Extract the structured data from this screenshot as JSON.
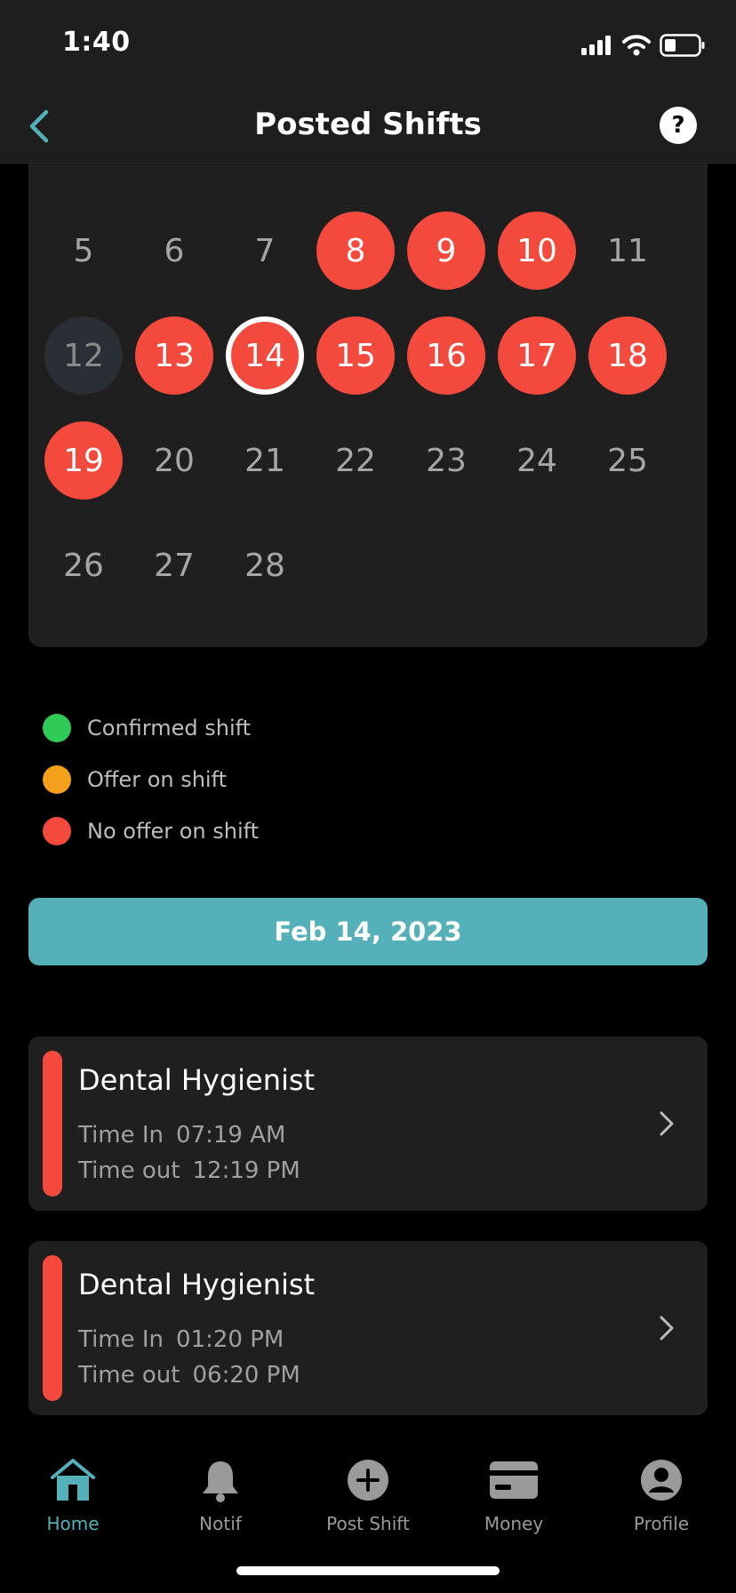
{
  "status_bar": {
    "time": "1:40"
  },
  "header": {
    "title": "Posted Shifts",
    "help_label": "?"
  },
  "calendar": {
    "days": [
      {
        "label": "5",
        "state": "none"
      },
      {
        "label": "6",
        "state": "none"
      },
      {
        "label": "7",
        "state": "none"
      },
      {
        "label": "8",
        "state": "no-offer"
      },
      {
        "label": "9",
        "state": "no-offer"
      },
      {
        "label": "10",
        "state": "no-offer"
      },
      {
        "label": "11",
        "state": "none"
      },
      {
        "label": "12",
        "state": "today"
      },
      {
        "label": "13",
        "state": "no-offer"
      },
      {
        "label": "14",
        "state": "selected"
      },
      {
        "label": "15",
        "state": "no-offer"
      },
      {
        "label": "16",
        "state": "no-offer"
      },
      {
        "label": "17",
        "state": "no-offer"
      },
      {
        "label": "18",
        "state": "no-offer"
      },
      {
        "label": "19",
        "state": "no-offer"
      },
      {
        "label": "20",
        "state": "none"
      },
      {
        "label": "21",
        "state": "none"
      },
      {
        "label": "22",
        "state": "none"
      },
      {
        "label": "23",
        "state": "none"
      },
      {
        "label": "24",
        "state": "none"
      },
      {
        "label": "25",
        "state": "none"
      },
      {
        "label": "26",
        "state": "none"
      },
      {
        "label": "27",
        "state": "none"
      },
      {
        "label": "28",
        "state": "none"
      }
    ]
  },
  "legend": [
    {
      "label": "Confirmed shift",
      "color": "#2ecc57"
    },
    {
      "label": "Offer on shift",
      "color": "#f5a01a"
    },
    {
      "label": "No offer on shift",
      "color": "#f44a3e"
    }
  ],
  "selected_date": "Feb 14, 2023",
  "shifts": [
    {
      "title": "Dental Hygienist",
      "time_in_label": "Time In",
      "time_in": "07:19 AM",
      "time_out_label": "Time out",
      "time_out": "12:19 PM"
    },
    {
      "title": "Dental Hygienist",
      "time_in_label": "Time In",
      "time_in": "01:20 PM",
      "time_out_label": "Time out",
      "time_out": "06:20 PM"
    }
  ],
  "tabs": [
    {
      "label": "Home",
      "icon": "home-icon",
      "active": true
    },
    {
      "label": "Notif",
      "icon": "bell-icon",
      "active": false
    },
    {
      "label": "Post Shift",
      "icon": "plus-circle-icon",
      "active": false
    },
    {
      "label": "Money",
      "icon": "card-icon",
      "active": false
    },
    {
      "label": "Profile",
      "icon": "profile-icon",
      "active": false
    }
  ],
  "colors": {
    "accent": "#54b1b9",
    "no_offer": "#f44a3e",
    "card_bg": "#1f1f1f"
  }
}
